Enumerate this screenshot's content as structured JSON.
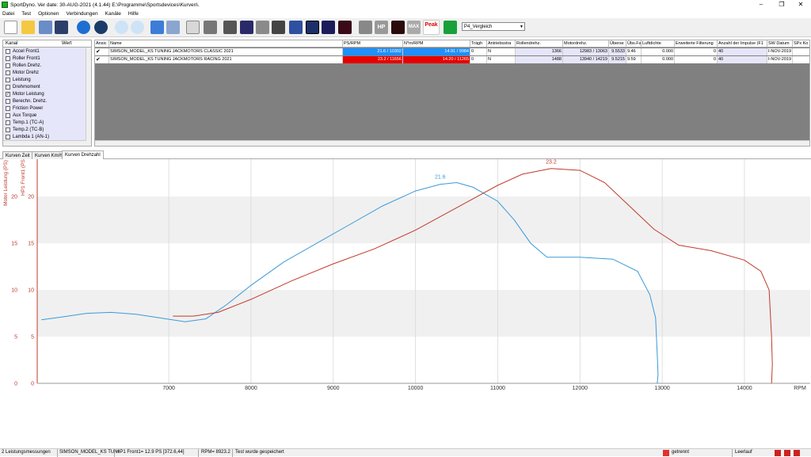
{
  "window": {
    "title": "SportDyno. Ver date: 30-AUG-2021 (4.1.44)  E:\\Programme\\Sportsdevices\\Kurven\\."
  },
  "menu": [
    "Datei",
    "Test",
    "Optionen",
    "Verbindungen",
    "Kanäle",
    "Hilfe"
  ],
  "toolbar": {
    "combo_value": "P4_Vergleich",
    "buttons": [
      "new-icon",
      "open-icon",
      "tree-icon",
      "save-icon",
      "play-icon",
      "record-icon",
      "zoom-in-icon",
      "zoom-out-icon",
      "refresh-icon",
      "cut-icon",
      "copy-icon",
      "print-icon",
      "tools-icon",
      "graph-icon",
      "settings-icon",
      "monitor-icon",
      "warning-icon",
      "chart1-icon",
      "chart2-icon",
      "chart3-icon",
      "chart4-icon",
      "blank-icon",
      "hp-icon",
      "curve-icon",
      "max-icon",
      "peak-icon",
      "green-curve-icon"
    ],
    "hp_label": "HP",
    "max_label": "MAX",
    "peak_label": "Peak"
  },
  "channels": {
    "col_kanal": "Kanal",
    "col_wert": "Wert",
    "items": [
      {
        "label": "Accel Front1",
        "checked": false
      },
      {
        "label": "Roller Front1",
        "checked": false
      },
      {
        "label": "Rollen Drehz.",
        "checked": false
      },
      {
        "label": "Motor Drehz",
        "checked": false
      },
      {
        "label": "Leistung",
        "checked": false
      },
      {
        "label": "Drehmoment",
        "checked": false
      },
      {
        "label": "Motor Leistung",
        "checked": true
      },
      {
        "label": "Berechn. Drehz.",
        "checked": false
      },
      {
        "label": "Friction Power",
        "checked": false
      },
      {
        "label": "Aux Torque",
        "checked": false
      },
      {
        "label": "Temp.1 (TC-A)",
        "checked": false
      },
      {
        "label": "Temp.2 (TC-B)",
        "checked": false
      },
      {
        "label": "Lambda 1 (AN-1)",
        "checked": false
      }
    ]
  },
  "grid": {
    "headers": [
      "Ansic",
      "Name",
      "PS/RPM",
      "N*m/RPM",
      "Trägh",
      "Antriebsstra",
      "Rollendrehz.",
      "Motordrehz.",
      "Überse",
      "Übs.Fa",
      "Luftdichte",
      "Erweiterte Filterung",
      "Anzahl der Impulse (F1",
      "SW Datum",
      "SPx Ko"
    ],
    "rows": [
      {
        "check": "✔",
        "name": "SIMSON_MODEL_KS TUNING JACKMOTORS CLASSIC 2021",
        "ps": "21.6 / 10302",
        "nm": "14.91 / 9984",
        "traeg": "0",
        "antrieb": "N",
        "rollen": "1366",
        "motor": "12983 / 13063",
        "ueber": "9.5533",
        "uebsfa": "9.46",
        "luft": "0.000",
        "filter": "0",
        "impulse": "40",
        "sw": "I-NOV-2019"
      },
      {
        "check": "✔",
        "name": "SIMSON_MODEL_KS TUNING  JACKMOTORS RACING 2021",
        "ps": "23.2 / 11656",
        "nm": "14.20 / 11265",
        "traeg": "0",
        "antrieb": "N",
        "rollen": "1488",
        "motor": "13940 / 14219",
        "ueber": "9.5215",
        "uebsfa": "9.59",
        "luft": "0.000",
        "filter": "0",
        "impulse": "40",
        "sw": "I-NOV-2019"
      }
    ]
  },
  "tabs": [
    "Kurven Zeit",
    "Kurven Km/h",
    "Kurven Drehzahl"
  ],
  "chart_data": {
    "type": "line",
    "ylabel1": "Motor Leistung (PS)",
    "ylabel2": "HP1 Front1 (PS)",
    "xlabel": "RPM",
    "xlim": [
      5400,
      14800
    ],
    "ylim": [
      0,
      24
    ],
    "xticks": [
      7000,
      8000,
      9000,
      10000,
      11000,
      12000,
      13000,
      14000
    ],
    "yticks": [
      0,
      5,
      10,
      15,
      20
    ],
    "series": [
      {
        "color": "#3a9ad9",
        "peak_label": "21.6",
        "peak_x": 10300,
        "peak_y": 21.6,
        "x": [
          5450,
          5700,
          6000,
          6300,
          6600,
          6900,
          7200,
          7450,
          7700,
          8000,
          8400,
          8800,
          9200,
          9600,
          10000,
          10300,
          10500,
          10700,
          11000,
          11200,
          11400,
          11600,
          12000,
          12400,
          12700,
          12850,
          12920,
          12940,
          12950,
          12940
        ],
        "y": [
          6.8,
          7.1,
          7.5,
          7.6,
          7.4,
          7.0,
          6.6,
          6.9,
          8.4,
          10.5,
          13.0,
          15.0,
          17.0,
          19.0,
          20.6,
          21.3,
          21.5,
          21.0,
          19.5,
          17.5,
          15.0,
          13.5,
          13.5,
          13.3,
          12.0,
          9.5,
          7.0,
          3.0,
          1.0,
          0.0
        ]
      },
      {
        "color": "#c0392b",
        "peak_label": "23.2",
        "peak_x": 11650,
        "peak_y": 23.2,
        "x": [
          7050,
          7300,
          7600,
          8000,
          8500,
          9000,
          9500,
          10000,
          10500,
          11000,
          11300,
          11650,
          12000,
          12300,
          12600,
          12900,
          13200,
          13600,
          14000,
          14200,
          14300,
          14330,
          14340,
          14330
        ],
        "y": [
          7.2,
          7.2,
          7.6,
          9.0,
          11.0,
          12.8,
          14.4,
          16.4,
          18.8,
          21.2,
          22.4,
          23.0,
          22.8,
          21.5,
          19.0,
          16.5,
          14.8,
          14.2,
          13.2,
          12.0,
          10.0,
          5.0,
          2.0,
          0.0
        ]
      }
    ]
  },
  "status": {
    "s1": "2 Leistungsmessungen",
    "s2": "SIMSON_MODEL_KS TUNI",
    "s3": "HP1 Front1= 12.9 PS  [372.6,44]",
    "s4": "RPM= 8923.2",
    "s5": "Test wurde gespeichert",
    "s6": "getrennt",
    "s7": "Leerlauf"
  },
  "colors": {
    "blue_cell": "#1e90ff",
    "red_cell": "#e60000",
    "lavender": "#e6e6fa"
  }
}
